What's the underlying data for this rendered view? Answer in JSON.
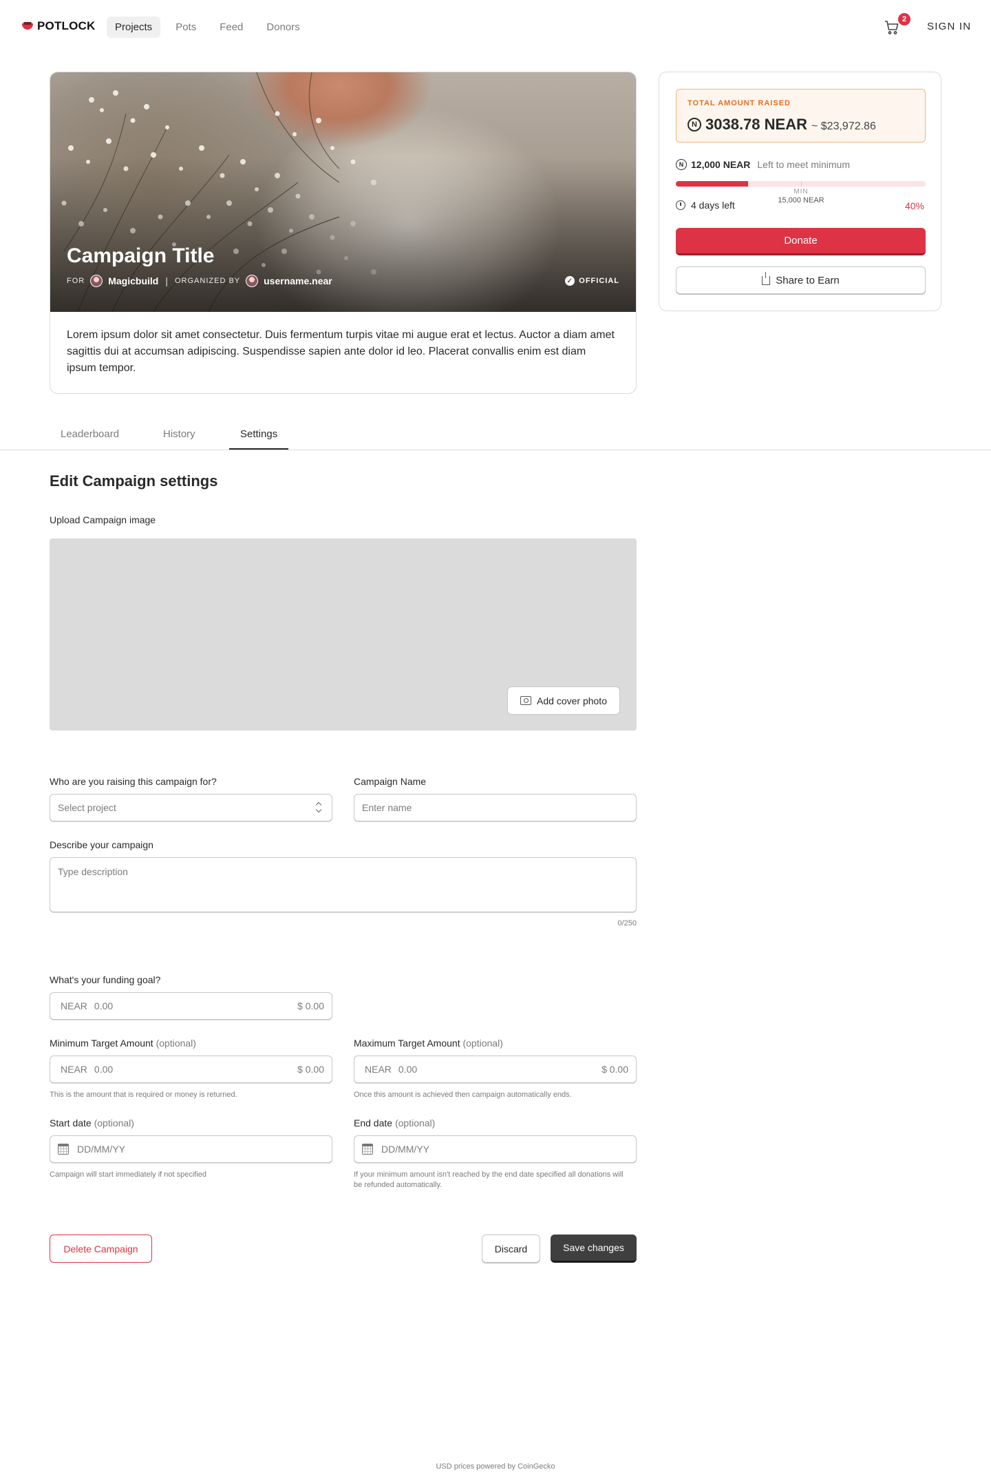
{
  "nav": {
    "logo": "POTLOCK",
    "links": [
      "Projects",
      "Pots",
      "Feed",
      "Donors"
    ],
    "active": "Projects",
    "cart_count": "2",
    "signin": "SIGN IN"
  },
  "campaign": {
    "title": "Campaign Title",
    "for_label": "FOR",
    "project_name": "Magicbuild",
    "organized_label": "ORGANIZED BY",
    "organizer": "username.near",
    "official_label": "OFFICIAL",
    "description": "Lorem ipsum dolor sit amet consectetur. Duis fermentum turpis vitae mi augue erat et lectus. Auctor a diam amet sagittis dui at accumsan adipiscing. Suspendisse sapien ante dolor id leo. Placerat convallis enim est diam ipsum tempor."
  },
  "funding": {
    "total_label": "TOTAL AMOUNT RAISED",
    "near_icon": "near-logo-icon",
    "raised_near": "3038.78 NEAR",
    "raised_usd": "~ $23,972.86",
    "left_amount": "12,000 NEAR",
    "left_text": "Left to meet minimum",
    "progress_fraction": 0.29,
    "min_label": "MIN",
    "min_value": "15,000 NEAR",
    "days_left": "4 days left",
    "percent": "40%",
    "donate_label": "Donate",
    "share_label": "Share to Earn",
    "accent": "#dd3345"
  },
  "tabs": [
    "Leaderboard",
    "History",
    "Settings"
  ],
  "active_tab": "Settings",
  "form": {
    "title": "Edit Campaign settings",
    "upload_label": "Upload Campaign image",
    "cover_button": "Add cover photo",
    "project_label": "Who are you raising this campaign for?",
    "project_placeholder": "Select project",
    "name_label": "Campaign Name",
    "name_placeholder": "Enter name",
    "desc_label": "Describe your campaign",
    "desc_placeholder": "Type description",
    "desc_counter": "0/250",
    "goal_label": "What's your funding goal?",
    "currency": "NEAR",
    "amount_placeholder": "0.00",
    "usd_value": "$ 0.00",
    "min_label": "Minimum Target Amount",
    "max_label": "Maximum Target Amount",
    "optional": "(optional)",
    "min_help": "This is the amount that is required or money is returned.",
    "max_help": "Once this amount is achieved then campaign automatically ends.",
    "start_label": "Start date",
    "end_label": "End date",
    "date_placeholder": "DD/MM/YY",
    "start_help": "Campaign will start immediately if not specified",
    "end_help": "If your minimum amount isn't reached by the end date specified all donations will be refunded automatically.",
    "delete_label": "Delete Campaign",
    "discard_label": "Discard",
    "save_label": "Save changes"
  },
  "footer": "USD prices powered by CoinGecko"
}
